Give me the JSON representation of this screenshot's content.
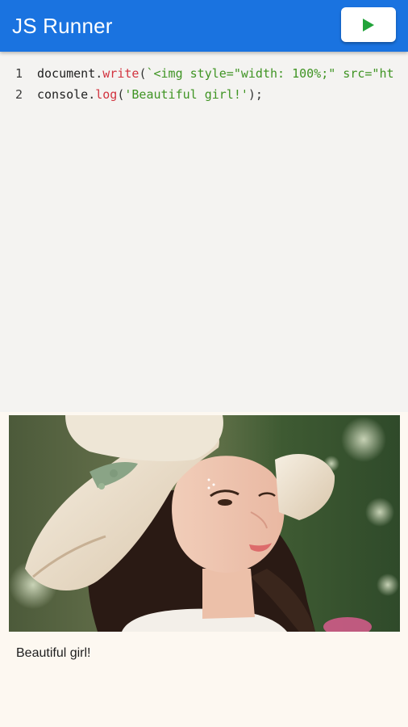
{
  "app": {
    "title": "JS Runner",
    "accent_color": "#1a73e0",
    "run_icon": "play-icon",
    "run_icon_color": "#21a339"
  },
  "editor": {
    "lines": [
      {
        "number": "1",
        "tokens": [
          {
            "type": "ident",
            "text": "document"
          },
          {
            "type": "punc",
            "text": "."
          },
          {
            "type": "method",
            "text": "write"
          },
          {
            "type": "punc",
            "text": "("
          },
          {
            "type": "string",
            "text": "`<img style=\"width: 100%;\" src=\"ht"
          }
        ]
      },
      {
        "number": "2",
        "tokens": [
          {
            "type": "ident",
            "text": "console"
          },
          {
            "type": "punc",
            "text": "."
          },
          {
            "type": "method",
            "text": "log"
          },
          {
            "type": "punc",
            "text": "("
          },
          {
            "type": "string",
            "text": "'Beautiful girl!'"
          },
          {
            "type": "punc",
            "text": ");"
          }
        ]
      }
    ]
  },
  "output": {
    "image_icon": "portrait-photo",
    "console_text": "Beautiful girl!"
  }
}
